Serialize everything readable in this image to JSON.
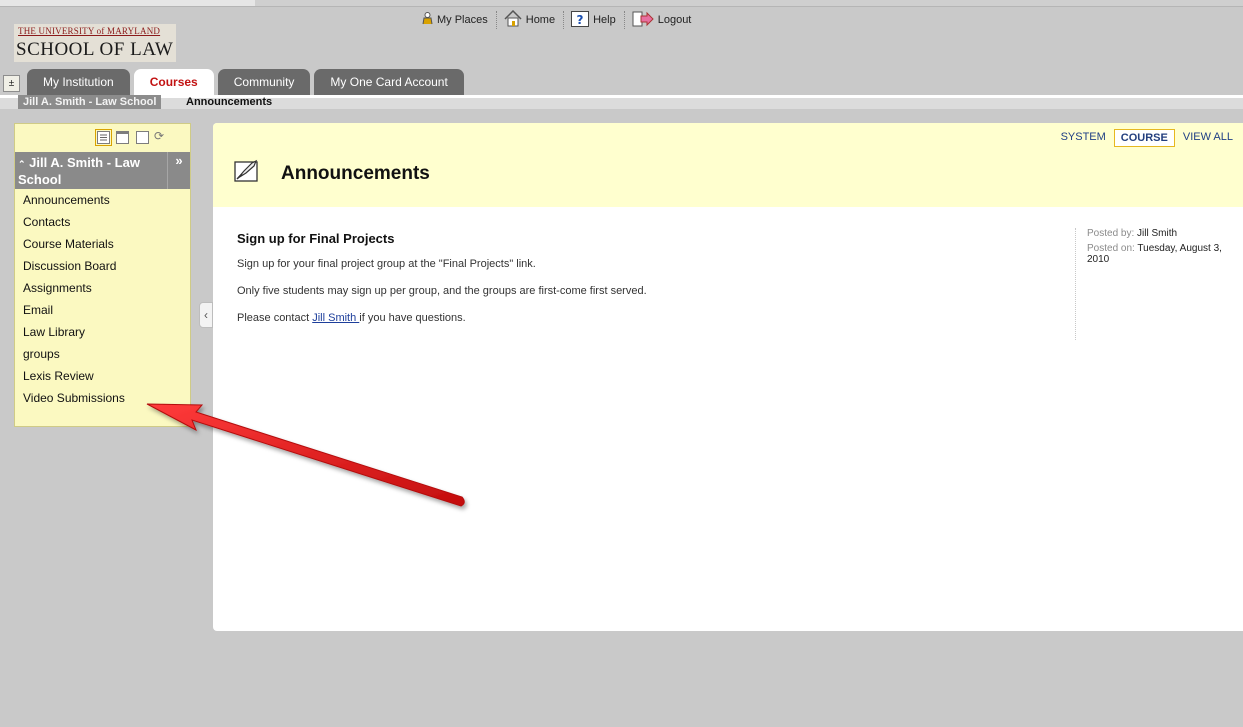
{
  "header": {
    "logo_line1": "THE UNIVERSITY of MARYLAND",
    "logo_line2": "SCHOOL OF LAW",
    "global_nav": [
      {
        "label": "My Places",
        "icon": "person-icon"
      },
      {
        "label": "Home",
        "icon": "home-icon"
      },
      {
        "label": "Help",
        "icon": "help-icon"
      },
      {
        "label": "Logout",
        "icon": "logout-icon"
      }
    ]
  },
  "tabs": [
    {
      "label": "My Institution",
      "active": false
    },
    {
      "label": "Courses",
      "active": true
    },
    {
      "label": "Community",
      "active": false
    },
    {
      "label": "My One Card Account",
      "active": false
    }
  ],
  "breadcrumb": {
    "course": "Jill A. Smith - Law School",
    "current": "Announcements"
  },
  "course_menu": {
    "title": "Jill A. Smith - Law School",
    "items": [
      "Announcements",
      "Contacts",
      "Course Materials",
      "Discussion Board",
      "Assignments",
      "Email",
      "Law Library",
      "groups",
      "Lexis Review",
      "Video Submissions"
    ]
  },
  "content": {
    "view_tabs": [
      {
        "label": "SYSTEM",
        "active": false
      },
      {
        "label": "COURSE",
        "active": true
      },
      {
        "label": "VIEW ALL",
        "active": false
      }
    ],
    "page_title": "Announcements",
    "announcement": {
      "title": "Sign up for Final Projects",
      "para1": "Sign up for your final project group at the \"Final Projects\" link.",
      "para2": "Only five students may sign up per group, and the groups are first-come first served.",
      "para3_before": "Please contact ",
      "para3_link": "Jill Smith ",
      "para3_after": "if you have questions.",
      "posted_by_label": "Posted by:",
      "posted_by": "Jill Smith",
      "posted_on_label": "Posted on:",
      "posted_on": "Tuesday, August 3, 2010"
    }
  },
  "colors": {
    "menu_bg": "#fbf9c1",
    "header_bg": "#ffffcf",
    "active_tab_text": "#c21212",
    "arrow": "#e01a1a"
  }
}
